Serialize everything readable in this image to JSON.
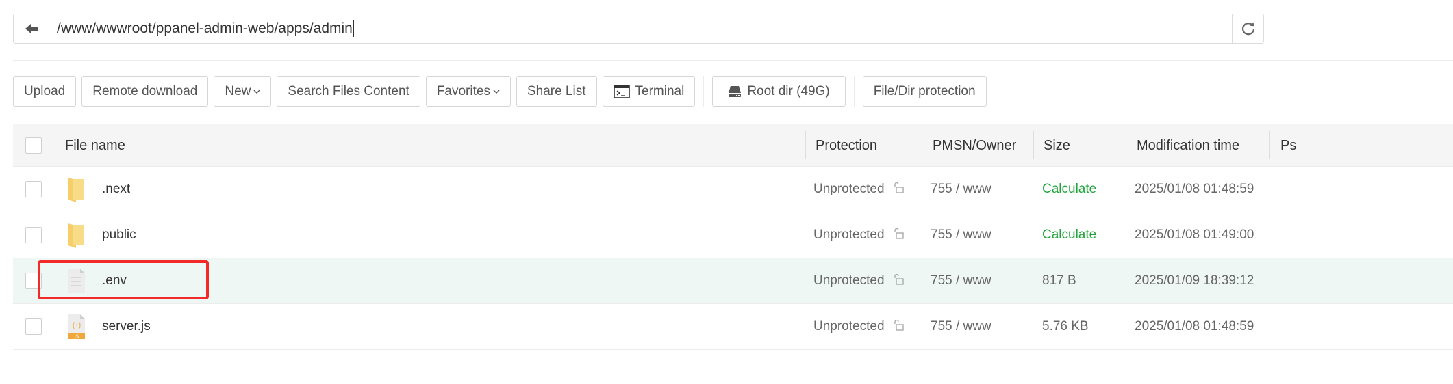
{
  "address_bar": {
    "path": "/www/wwwroot/ppanel-admin-web/apps/admin",
    "back_icon": "arrow-left-icon",
    "refresh_icon": "refresh-icon"
  },
  "toolbar": {
    "upload": "Upload",
    "remote_download": "Remote download",
    "new": "New",
    "search_files_content": "Search Files Content",
    "favorites": "Favorites",
    "share_list": "Share List",
    "terminal": "Terminal",
    "root_dir": "Root dir (49G)",
    "file_dir_protection": "File/Dir protection"
  },
  "table": {
    "columns": {
      "file_name": "File name",
      "protection": "Protection",
      "pmsn_owner": "PMSN/Owner",
      "size": "Size",
      "modification_time": "Modification time",
      "ps": "Ps"
    },
    "rows": [
      {
        "name": ".next",
        "type": "folder",
        "protection": "Unprotected",
        "pmsn_owner": "755 / www",
        "size": "Calculate",
        "size_is_action": true,
        "mtime": "2025/01/08 01:48:59"
      },
      {
        "name": "public",
        "type": "folder",
        "protection": "Unprotected",
        "pmsn_owner": "755 / www",
        "size": "Calculate",
        "size_is_action": true,
        "mtime": "2025/01/08 01:49:00"
      },
      {
        "name": ".env",
        "type": "text-file",
        "protection": "Unprotected",
        "pmsn_owner": "755 / www",
        "size": "817 B",
        "size_is_action": false,
        "mtime": "2025/01/09 18:39:12",
        "highlighted": true
      },
      {
        "name": "server.js",
        "type": "js-file",
        "protection": "Unprotected",
        "pmsn_owner": "755 / www",
        "size": "5.76 KB",
        "size_is_action": false,
        "mtime": "2025/01/08 01:48:59"
      }
    ]
  },
  "colors": {
    "accent_green": "#20a53a",
    "highlight_row": "#eff7f4",
    "annotation_red": "#f22a2a"
  }
}
